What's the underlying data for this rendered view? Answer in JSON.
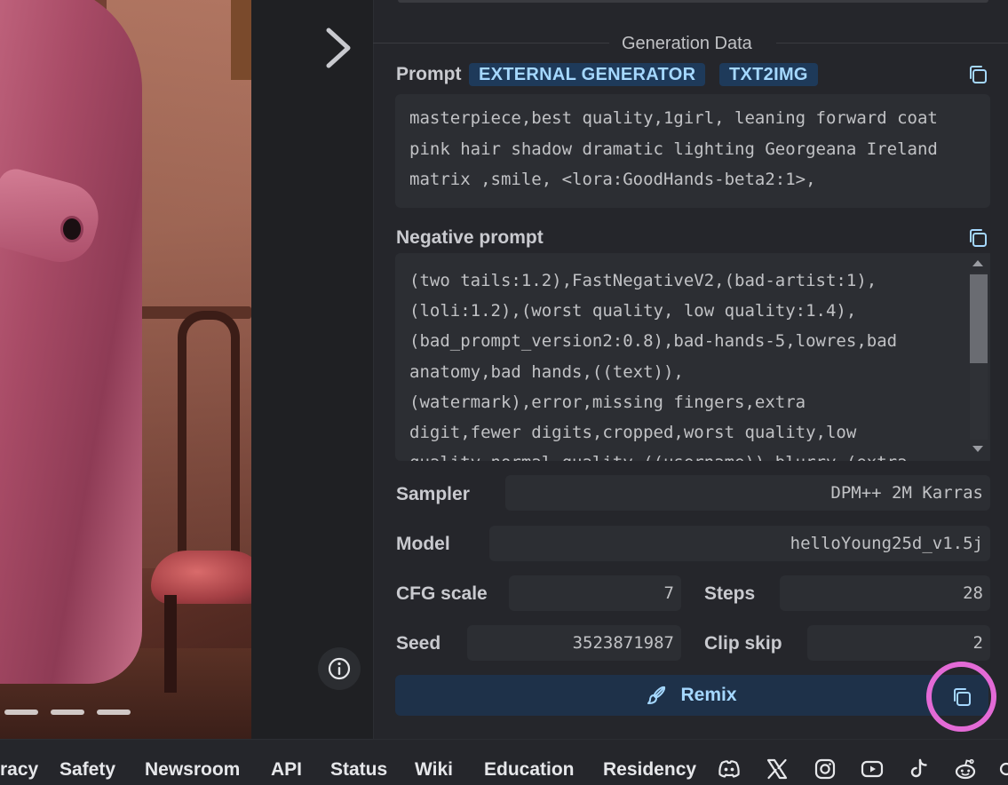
{
  "generation": {
    "title": "Generation Data",
    "prompt_label": "Prompt",
    "badges": [
      "EXTERNAL GENERATOR",
      "TXT2IMG"
    ],
    "prompt_text": "masterpiece,best quality,1girl, leaning forward coat pink hair shadow dramatic lighting Georgeana Ireland matrix ,smile, <lora:GoodHands-beta2:1>,",
    "negative_label": "Negative prompt",
    "negative_text": "(two tails:1.2),FastNegativeV2,(bad-artist:1),\n(loli:1.2),(worst quality, low quality:1.4),\n(bad_prompt_version2:0.8),bad-hands-5,lowres,bad\nanatomy,bad hands,((text)),\n(watermark),error,missing fingers,extra\ndigit,fewer digits,cropped,worst quality,low\nquality,normal quality,((username)),blurry,(extra",
    "sampler_label": "Sampler",
    "sampler_value": "DPM++ 2M Karras",
    "model_label": "Model",
    "model_value": "helloYoung25d_v1.5j",
    "cfg_label": "CFG scale",
    "cfg_value": "7",
    "steps_label": "Steps",
    "steps_value": "28",
    "seed_label": "Seed",
    "seed_value": "3523871987",
    "clip_label": "Clip skip",
    "clip_value": "2",
    "remix_label": "Remix"
  },
  "footer": {
    "links": [
      "racy",
      "Safety",
      "Newsroom",
      "API",
      "Status",
      "Wiki",
      "Education",
      "Residency"
    ],
    "socials": [
      "discord-icon",
      "x-icon",
      "instagram-icon",
      "youtube-icon",
      "tiktok-icon",
      "reddit-icon"
    ]
  },
  "colors": {
    "panel_bg": "#25262b",
    "badge_bg": "#1e3a5a",
    "badge_text": "#a5d8ff",
    "highlight_ring": "#e36ad6"
  }
}
